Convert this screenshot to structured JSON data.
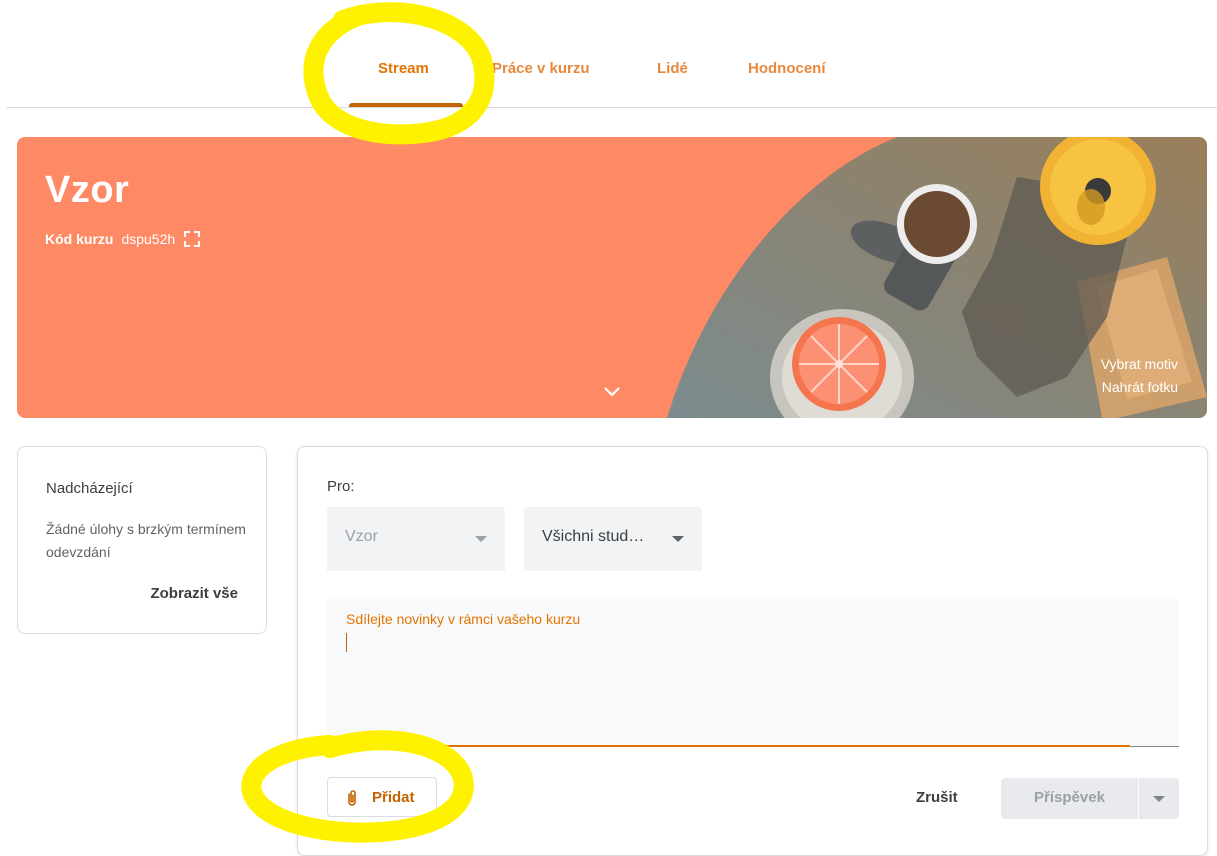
{
  "tabs": [
    {
      "label": "Stream",
      "active": true
    },
    {
      "label": "Práce v kurzu",
      "active": false
    },
    {
      "label": "Lidé",
      "active": false
    },
    {
      "label": "Hodnocení",
      "active": false
    }
  ],
  "banner": {
    "title": "Vzor",
    "course_code_label": "Kód kurzu",
    "course_code": "dspu52h",
    "theme_link": "Vybrat motiv",
    "upload_link": "Nahrát fotku",
    "color": "#fe8a65"
  },
  "upcoming": {
    "title": "Nadcházející",
    "text": "Žádné úlohy s brzkým termínem odevzdání",
    "view_all": "Zobrazit vše"
  },
  "post": {
    "for_label": "Pro:",
    "class_select": "Vzor",
    "students_select": "Všichni stud…",
    "placeholder": "Sdílejte novinky v rámci vašeho kurzu",
    "add_label": "Přidat",
    "cancel_label": "Zrušit",
    "post_label": "Příspěvek"
  },
  "icons": {
    "fullscreen": "fullscreen-icon",
    "expand": "chevron-down-icon",
    "attach": "paperclip-icon",
    "dropdown": "caret-down-icon"
  },
  "colors": {
    "accent": "#e37400",
    "highlight": "#fff200"
  }
}
